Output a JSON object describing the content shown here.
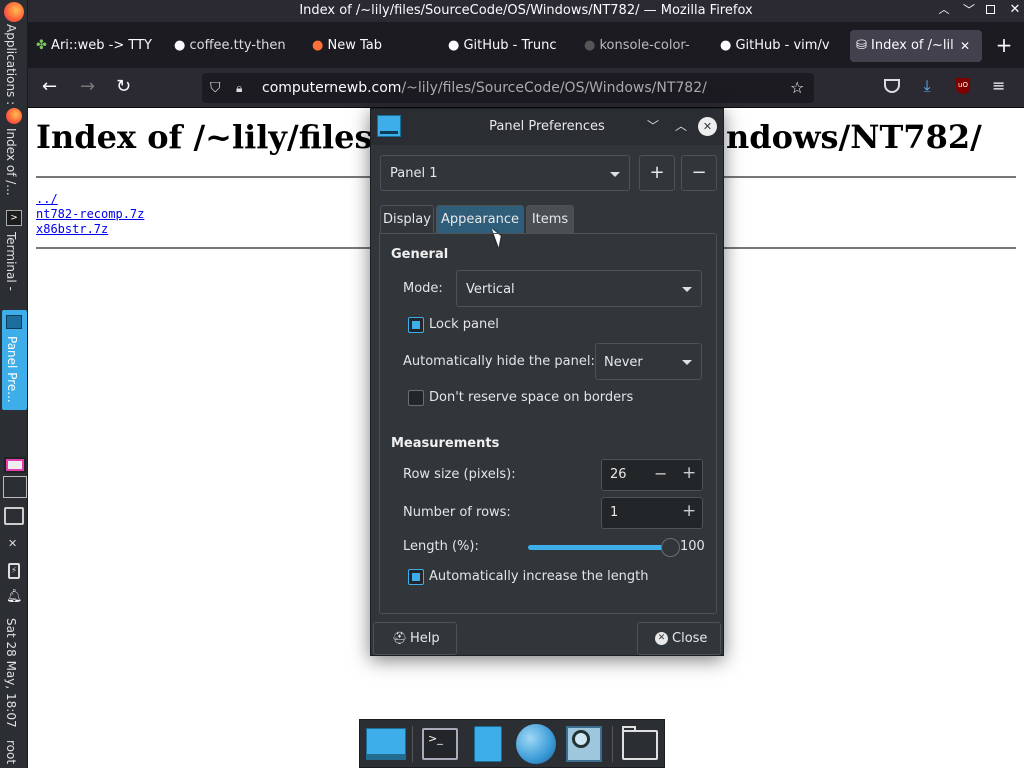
{
  "left_panel": {
    "applications_label": "Applications :",
    "task_firefox": "Index of /...",
    "task_terminal": "Terminal -",
    "task_panel": "Panel Pre...",
    "clock": "Sat 28 May, 18:07",
    "user": "root"
  },
  "firefox": {
    "window_title": "Index of /~lily/files/SourceCode/OS/Windows/NT782/ — Mozilla Firefox",
    "tabs": [
      {
        "label": "Ari::web -> TTY"
      },
      {
        "label": "coffee.tty-then"
      },
      {
        "label": "New Tab"
      },
      {
        "label": "GitHub - Trunc"
      },
      {
        "label": "konsole-color-"
      },
      {
        "label": "GitHub - vim/v"
      },
      {
        "label": "Index of /~lil"
      }
    ],
    "url_domain": "computernewb.com",
    "url_path": "/~lily/files/SourceCode/OS/Windows/NT782/",
    "page": {
      "heading_left": "Index of /~lily/files",
      "heading_right": "ndows/NT782/",
      "links": [
        "../",
        "nt782-recomp.7z",
        "x86bstr.7z"
      ]
    }
  },
  "dialog": {
    "title": "Panel Preferences",
    "panel_select": "Panel 1",
    "tabs": [
      "Display",
      "Appearance",
      "Items"
    ],
    "general_header": "General",
    "mode_label": "Mode:",
    "mode_value": "Vertical",
    "lock_panel_label": "Lock panel",
    "lock_panel_checked": true,
    "autohide_label": "Automatically hide the panel:",
    "autohide_value": "Never",
    "reserve_label": "Don't reserve space on borders",
    "reserve_checked": false,
    "measurements_header": "Measurements",
    "row_size_label": "Row size (pixels):",
    "row_size_value": "26",
    "rows_label": "Number of rows:",
    "rows_value": "1",
    "length_label": "Length (%):",
    "length_value": "100",
    "auto_length_label": "Automatically increase the length",
    "auto_length_checked": true,
    "help_label": "Help",
    "close_label": "Close"
  },
  "colors": {
    "accent": "#3daee9",
    "dialog_bg": "#31363b",
    "firefox_dark": "#2b2a33"
  }
}
